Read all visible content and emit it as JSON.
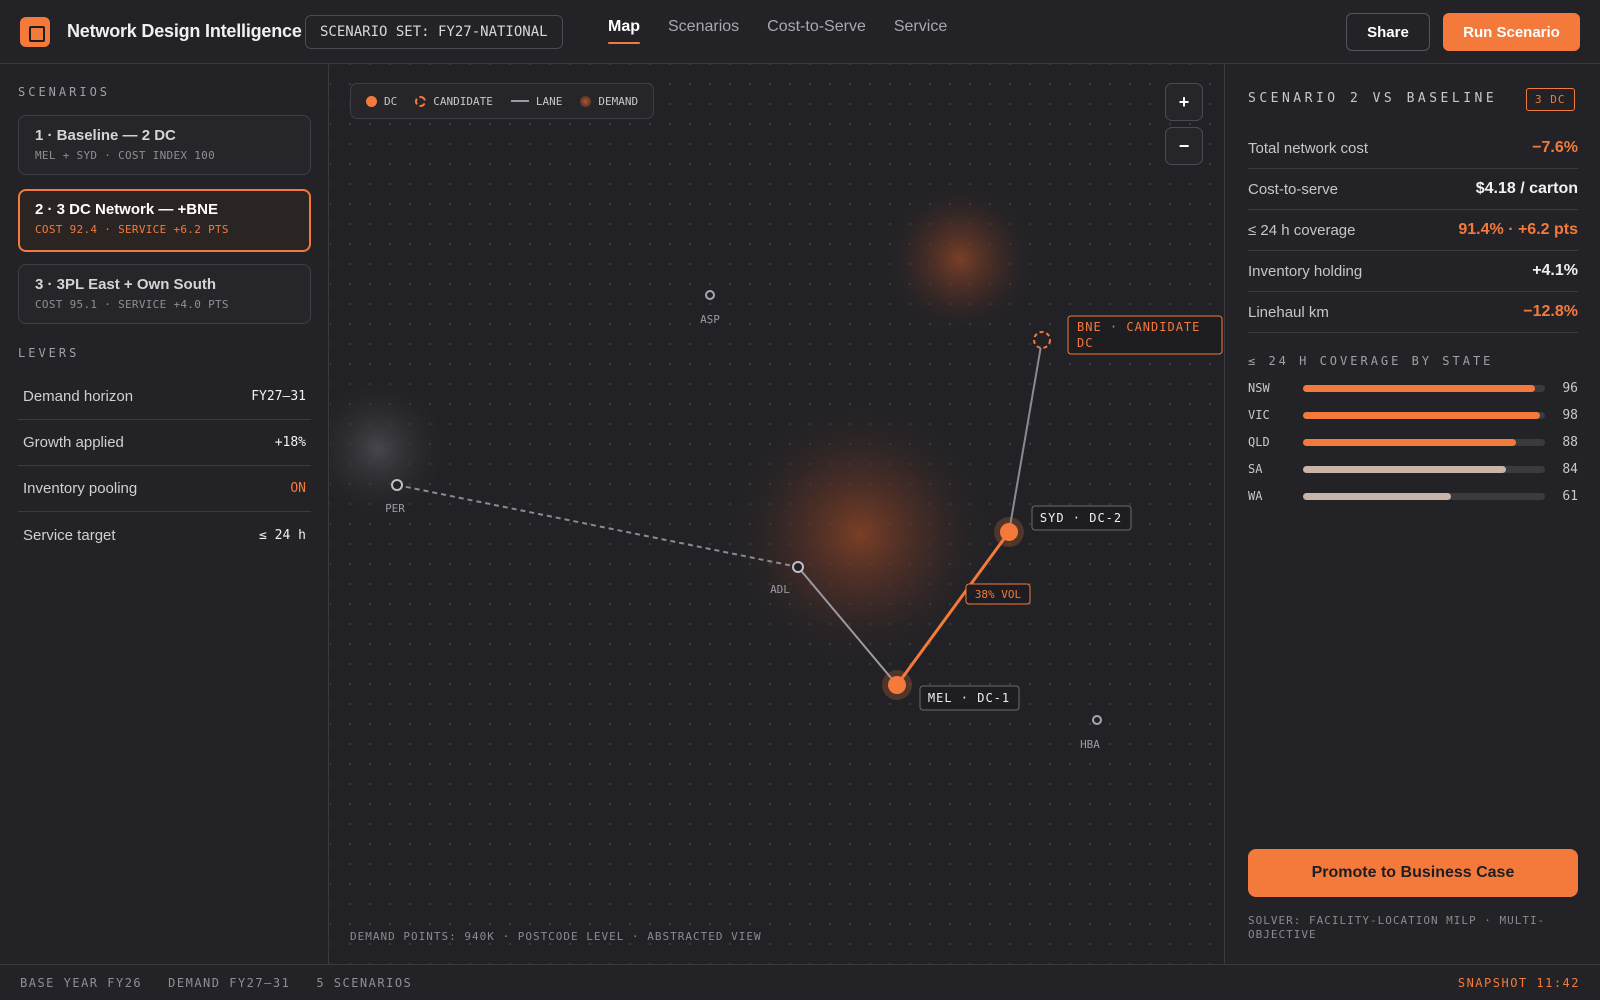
{
  "header": {
    "app_title": "Network Design Intelligence",
    "logo_icon": "square-logo-icon",
    "scenario_set": "SCENARIO SET: FY27-NATIONAL",
    "nav": [
      "Map",
      "Scenarios",
      "Cost-to-Serve",
      "Service"
    ],
    "active_nav": "Map",
    "share_label": "Share",
    "run_label": "Run Scenario"
  },
  "sidebar": {
    "scenarios_label": "SCENARIOS",
    "scenarios": [
      {
        "title": "1 · Baseline — 2 DC",
        "subtitle": "MEL + SYD · COST INDEX 100"
      },
      {
        "title": "2 · 3 DC Network — +BNE",
        "subtitle": "COST 92.4 · SERVICE +6.2 PTS"
      },
      {
        "title": "3 · 3PL East + Own South",
        "subtitle": "COST 95.1 · SERVICE +4.0 PTS"
      }
    ],
    "active_scenario": 1,
    "levers_label": "LEVERS",
    "levers": [
      {
        "name": "Demand horizon",
        "value": "FY27–31"
      },
      {
        "name": "Growth applied",
        "value": "+18%"
      },
      {
        "name": "Inventory pooling",
        "value": "ON"
      },
      {
        "name": "Service target",
        "value": "≤ 24 h"
      }
    ]
  },
  "map": {
    "legend": {
      "dc": "DC",
      "candidate": "CANDIDATE",
      "lane": "LANE",
      "demand": "DEMAND"
    },
    "zoom_in": "+",
    "zoom_out": "−",
    "cities": {
      "asp": "ASP",
      "per": "PER",
      "adl": "ADL",
      "hba": "HBA"
    },
    "dc_labels": {
      "syd": "SYD · DC-2",
      "mel": "MEL · DC-1"
    },
    "candidate_label_line1": "BNE · CANDIDATE",
    "candidate_label_line2": "DC",
    "lane_volume": "38% VOL",
    "footer": "DEMAND POINTS: 940K · POSTCODE LEVEL · ABSTRACTED VIEW",
    "colors": {
      "accent": "#f47a3c",
      "lane": "#9a9aa0",
      "city": "#a8a8ae"
    }
  },
  "panel": {
    "title": "SCENARIO 2 VS BASELINE",
    "badge": "3 DC",
    "kpis": [
      {
        "label": "Total network cost",
        "value": "−7.6%"
      },
      {
        "label": "Cost-to-serve",
        "value": "$4.18 / carton"
      },
      {
        "label": "≤ 24 h coverage",
        "value": "91.4% · +6.2 pts"
      },
      {
        "label": "Inventory holding",
        "value": "+4.1%"
      },
      {
        "label": "Linehaul km",
        "value": "−12.8%"
      }
    ],
    "coverage_title": "≤ 24 H COVERAGE BY STATE",
    "coverage": [
      {
        "state": "NSW",
        "value": 96
      },
      {
        "state": "VIC",
        "value": 98
      },
      {
        "state": "QLD",
        "value": 88
      },
      {
        "state": "SA",
        "value": 84
      },
      {
        "state": "WA",
        "value": 61
      }
    ],
    "promote_label": "Promote to Business Case",
    "solver": "SOLVER: FACILITY-LOCATION MILP · MULTI-OBJECTIVE"
  },
  "footer": {
    "base_year": "BASE YEAR FY26",
    "demand": "DEMAND FY27–31",
    "scenarios": "5 SCENARIOS",
    "snapshot": "SNAPSHOT 11:42"
  }
}
